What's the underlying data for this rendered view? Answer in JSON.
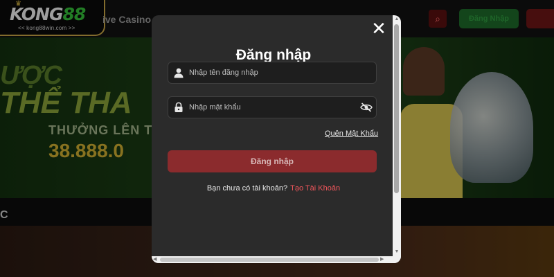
{
  "site": {
    "logo_text": "KONG",
    "logo_number": "88",
    "logo_subtitle": "<< kong88win.com >>",
    "nav_live_casino": "ive Casino",
    "top_login_label": "Đăng Nhập"
  },
  "banner": {
    "line1": "ƯỢC",
    "line2": "THỂ THA",
    "line3": "THƯỞNG LÊN TỚ",
    "line4": "38.888.0"
  },
  "section": {
    "title": "C"
  },
  "login_modal": {
    "title": "Đăng nhập",
    "username_placeholder": "Nhập tên đăng nhập",
    "password_placeholder": "Nhập mật khẩu",
    "forgot_password": "Quên Mật Khẩu",
    "submit_label": "Đăng nhập",
    "no_account_text": "Bạn chưa có tài khoản?",
    "create_account_link": "Tạo Tài Khoản"
  },
  "colors": {
    "primary_button": "#8b2b2d",
    "link_accent": "#f0565b",
    "modal_bg": "#2b2b2b",
    "logo_border": "#c9a646"
  }
}
